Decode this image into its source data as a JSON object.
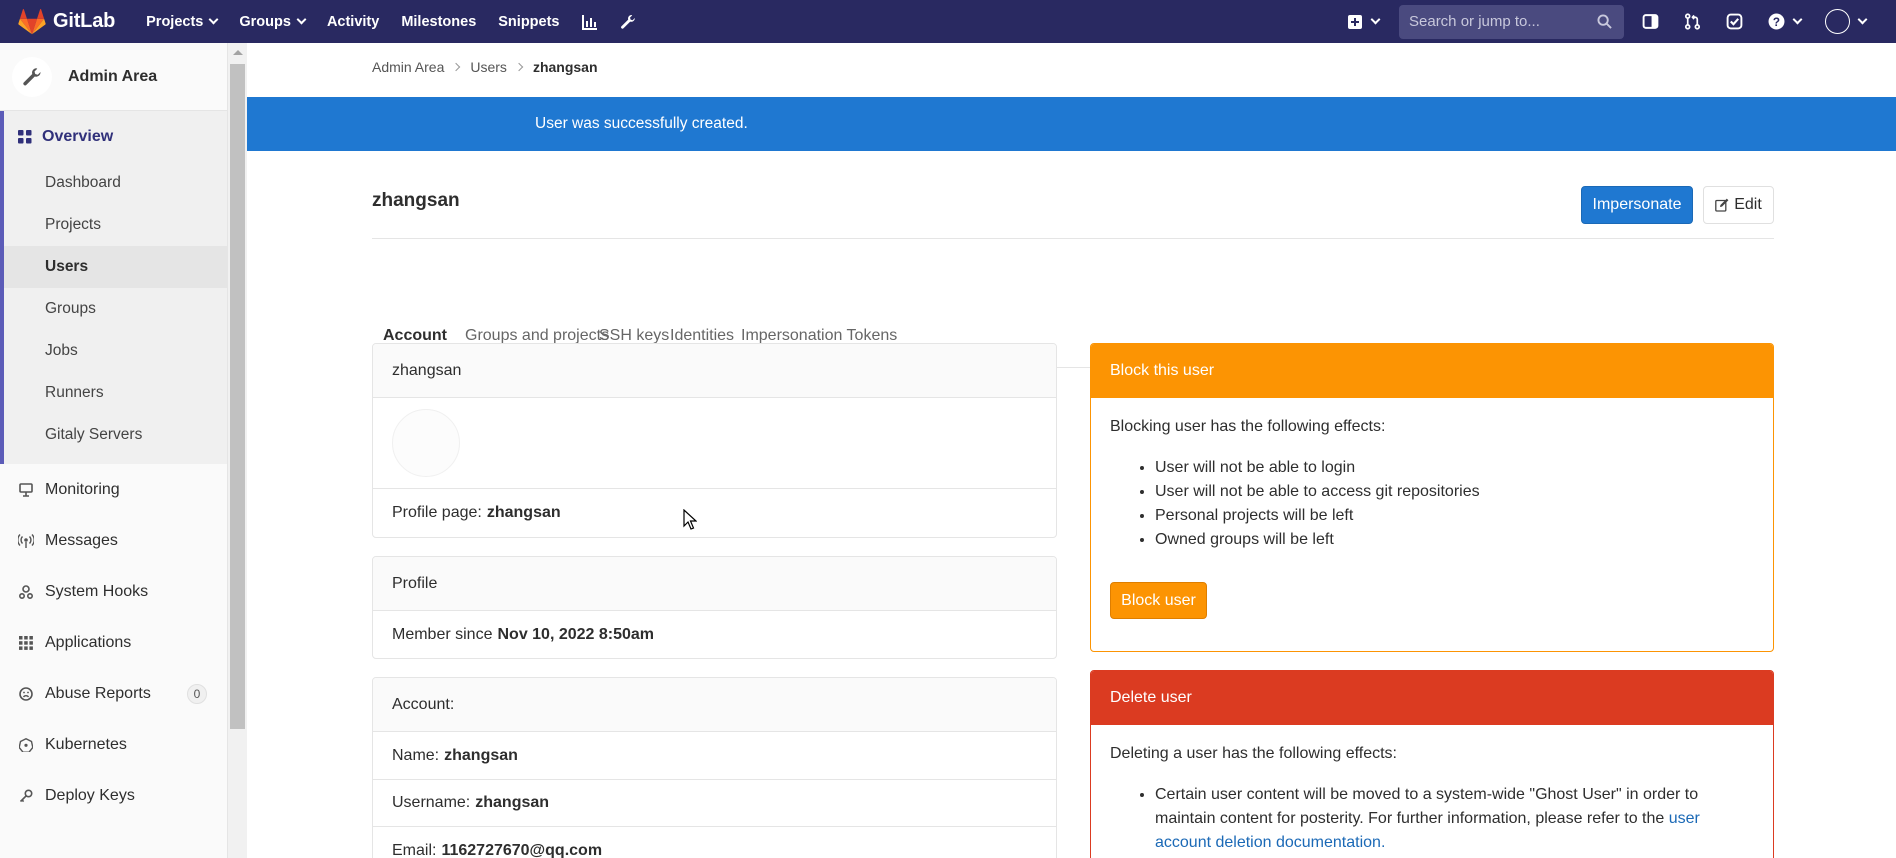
{
  "app": {
    "name": "GitLab"
  },
  "topnav": {
    "items": [
      {
        "label": "Projects",
        "dropdown": true
      },
      {
        "label": "Groups",
        "dropdown": true
      },
      {
        "label": "Activity",
        "dropdown": false
      },
      {
        "label": "Milestones",
        "dropdown": false
      },
      {
        "label": "Snippets",
        "dropdown": false
      }
    ],
    "icons": [
      "chart-icon",
      "wrench-icon"
    ],
    "search_placeholder": "Search or jump to...",
    "right_icons": [
      "plus-square-icon",
      "sidebar-icon",
      "merge-request-icon",
      "todo-check-icon",
      "help-icon",
      "user-avatar"
    ]
  },
  "sidebar": {
    "context_title": "Admin Area",
    "overview_label": "Overview",
    "sub_items": [
      "Dashboard",
      "Projects",
      "Users",
      "Groups",
      "Jobs",
      "Runners",
      "Gitaly Servers"
    ],
    "active_sub_item": "Users",
    "items": [
      {
        "label": "Monitoring",
        "icon": "monitor-icon"
      },
      {
        "label": "Messages",
        "icon": "broadcast-icon"
      },
      {
        "label": "System Hooks",
        "icon": "hook-icon"
      },
      {
        "label": "Applications",
        "icon": "apps-grid-icon"
      },
      {
        "label": "Abuse Reports",
        "icon": "abuse-face-icon",
        "count": "0"
      },
      {
        "label": "Kubernetes",
        "icon": "kubernetes-icon"
      },
      {
        "label": "Deploy Keys",
        "icon": "key-icon"
      }
    ]
  },
  "breadcrumb": {
    "items": [
      "Admin Area",
      "Users"
    ],
    "current": "zhangsan"
  },
  "flash": {
    "message": "User was successfully created."
  },
  "user": {
    "title": "zhangsan",
    "impersonate_label": "Impersonate",
    "edit_label": "Edit"
  },
  "tabs": [
    "Account",
    "Groups and projects",
    "SSH keys",
    "Identities",
    "Impersonation Tokens"
  ],
  "active_tab": "Account",
  "profile_card": {
    "header": "zhangsan",
    "profile_page_label": "Profile page:",
    "profile_page_value": "zhangsan"
  },
  "profile_info_card": {
    "header": "Profile",
    "member_since_label": "Member since",
    "member_since_value": "Nov 10, 2022 8:50am"
  },
  "account_card": {
    "header": "Account:",
    "name_label": "Name:",
    "name_value": "zhangsan",
    "username_label": "Username:",
    "username_value": "zhangsan",
    "email_label": "Email:",
    "email_value": "1162727670@qq.com"
  },
  "block_card": {
    "header": "Block this user",
    "intro": "Blocking user has the following effects:",
    "effects": [
      "User will not be able to login",
      "User will not be able to access git repositories",
      "Personal projects will be left",
      "Owned groups will be left"
    ],
    "button_label": "Block user"
  },
  "delete_card": {
    "header": "Delete user",
    "intro": "Deleting a user has the following effects:",
    "effect_text": "Certain user content will be moved to a system-wide \"Ghost User\" in order to maintain content for posterity. For further information, please refer to the",
    "link_text": "user account deletion documentation."
  },
  "colors": {
    "navbar": "#292961",
    "primary": "#1f78d1",
    "warning": "#fc9403",
    "danger": "#db3b21",
    "sidebar_accent": "#5c5cb8"
  }
}
